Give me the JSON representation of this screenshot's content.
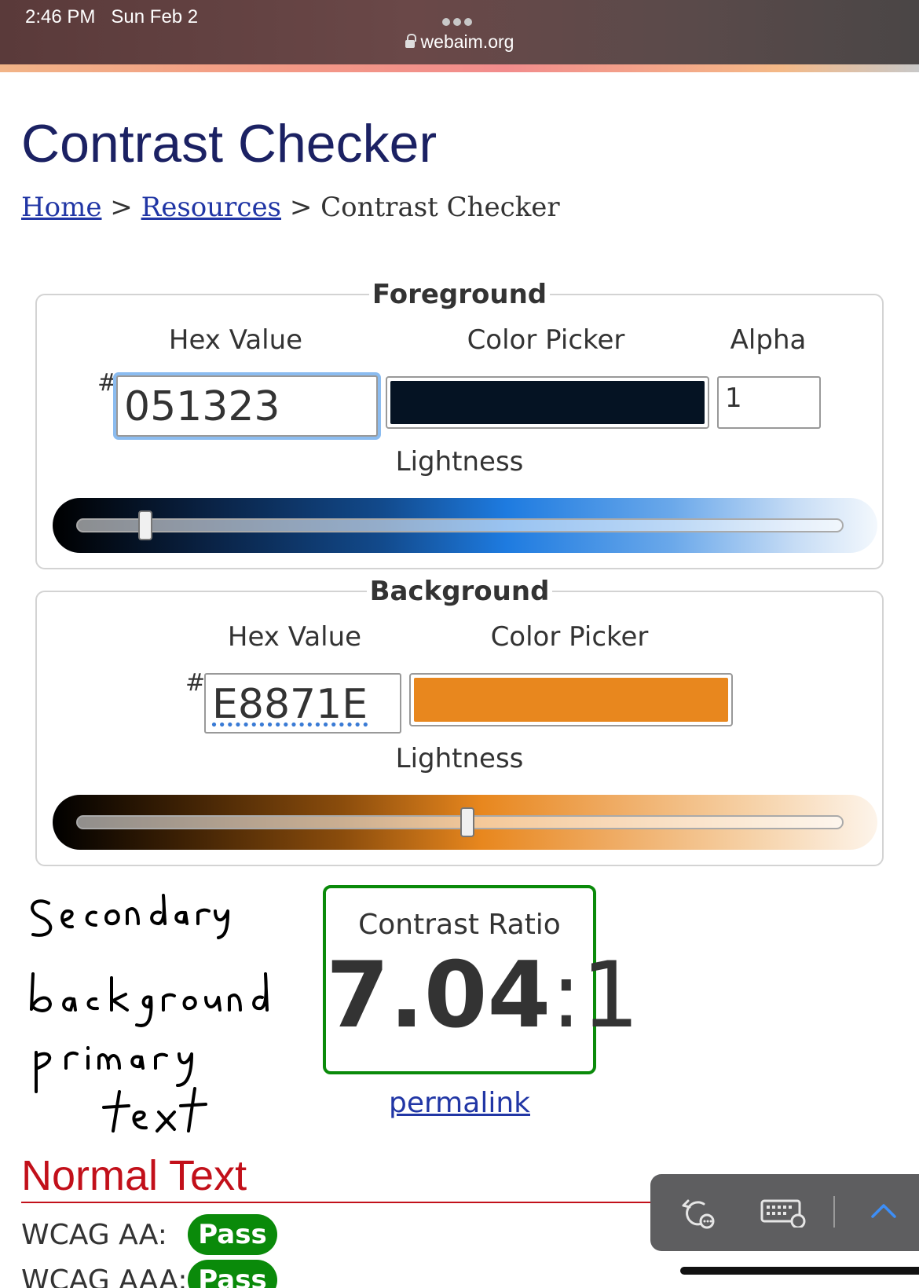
{
  "status_bar": {
    "time": "2:46 PM",
    "date": "Sun Feb 2",
    "url": "webaim.org"
  },
  "page": {
    "title": "Contrast Checker",
    "breadcrumb": {
      "home": "Home",
      "sep1": ">",
      "resources": "Resources",
      "sep2": ">",
      "current": "Contrast Checker"
    }
  },
  "foreground": {
    "legend": "Foreground",
    "hex_label": "Hex Value",
    "hash": "#",
    "hex_value": "051323",
    "picker_label": "Color Picker",
    "color": "#051323",
    "alpha_label": "Alpha",
    "alpha_value": "1",
    "lightness_label": "Lightness",
    "lightness_fraction": 0.09
  },
  "background": {
    "legend": "Background",
    "hex_label": "Hex Value",
    "hash": "#",
    "hex_value": "E8871E",
    "picker_label": "Color Picker",
    "color": "#E8871E",
    "lightness_label": "Lightness",
    "lightness_fraction": 0.51
  },
  "annotation": {
    "line1": "Secondary",
    "line2": "background",
    "line3": "primary",
    "line4": "text"
  },
  "result": {
    "label": "Contrast Ratio",
    "ratio_main": "7.04",
    "ratio_suffix": ":1",
    "permalink": "permalink"
  },
  "normal_text": {
    "heading": "Normal Text",
    "wcag_aa_label": "WCAG AA:",
    "wcag_aa_result": "Pass",
    "wcag_aaa_label": "WCAG AAA:",
    "wcag_aaa_result": "Pass"
  },
  "colors": {
    "title": "#1b2163",
    "link": "#2136a5",
    "pass": "#0a8a0a",
    "heading_red": "#c2101a"
  },
  "keyboard_bar": {
    "icons": [
      "undo-icon",
      "keyboard-icon",
      "chevron-up-icon"
    ]
  }
}
